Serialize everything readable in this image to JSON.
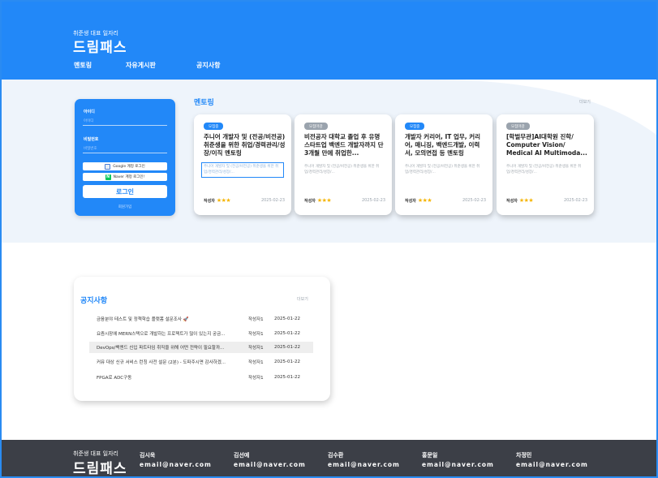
{
  "header": {
    "subtitle": "취준생 대표 일자리",
    "brand": "드림패스",
    "nav": [
      "멘토링",
      "자유게시판",
      "공지사항"
    ]
  },
  "login": {
    "id_label": "아이디",
    "id_placeholder": "아이디",
    "pw_label": "비밀번호",
    "pw_placeholder": "비밀번호",
    "google_label": "Google 계정 로그인",
    "naver_label": "Naver 계정 로그인!",
    "login_button": "로그인",
    "signup_link": "회원가입"
  },
  "mentoring": {
    "title": "멘토링",
    "more": "더보기",
    "cards": [
      {
        "badge": "모집중",
        "status": "open",
        "title": "주니어 개발자 및 (전공/비전공) 취준생을 위한 취업/경력관리/성장/이직 멘토링",
        "desc": "주니어 개발자 및 (전공/비전공) 취준생을 위한 취업/경력관리/성장/...",
        "author": "작성자",
        "stars": "★★★",
        "date": "2025-02-23"
      },
      {
        "badge": "모집마감",
        "status": "closed",
        "title": "비전공자 대학교 졸업 후 유명 스타트업 백엔드 개발자까지 단 3개월 만에 취업한...",
        "desc": "주니어 개발자 및 (전공/비전공) 취준생을 위한 취업/경력관리/성장/...",
        "author": "작성자",
        "stars": "★★★",
        "date": "2025-02-23"
      },
      {
        "badge": "모집중",
        "status": "open",
        "title": "개발자 커리어, IT 업무, 커리어, 매니징, 백엔드개발, 이력서, 모의면접 등 멘토링",
        "desc": "주니어 개발자 및 (전공/비전공) 취준생을 위한 취업/경력관리/성장/...",
        "author": "작성자",
        "stars": "★★★",
        "date": "2025-02-23"
      },
      {
        "badge": "모집마감",
        "status": "closed",
        "title": "[학벌무관]AI대학원 진학/ Computer Vision/ Medical AI Multimoda...",
        "desc": "주니어 개발자 및 (전공/비전공) 취준생을 위한 취업/경력관리/성장/...",
        "author": "작성자",
        "stars": "★★★",
        "date": "2025-02-23"
      }
    ]
  },
  "notices": {
    "title": "공지사항",
    "more": "더보기",
    "rows": [
      {
        "title": "금융분야 테스트 및 정책학습 플랫폼 설문조사 🚀",
        "author": "작성자1",
        "date": "2025-01-22"
      },
      {
        "title": "요즘시장에 MERN스택으로 개발하는 프로젝트가 많이 있는지 궁금...",
        "author": "작성자1",
        "date": "2025-01-22"
      },
      {
        "title": "DevOps/백엔드 신입 파트타임 취직을 위해 어떤 전략이 필요할까...",
        "author": "작성자1",
        "date": "2025-01-22"
      },
      {
        "title": "커뮤 대상 신규 서비스 런칭 사전 설문 (2분) - 도파주시면 감사하겠...",
        "author": "작성자1",
        "date": "2025-01-22"
      },
      {
        "title": "FPGA로 ADC구동",
        "author": "작성자1",
        "date": "2025-01-22"
      }
    ]
  },
  "footer": {
    "subtitle": "취준생 대표 일자리",
    "brand": "드림패스",
    "people": [
      {
        "name": "김시욱",
        "email": "email@naver.com"
      },
      {
        "name": "김선예",
        "email": "email@naver.com"
      },
      {
        "name": "김수환",
        "email": "email@naver.com"
      },
      {
        "name": "홍문일",
        "email": "email@naver.com"
      },
      {
        "name": "차정민",
        "email": "email@naver.com"
      }
    ]
  },
  "colors": {
    "primary": "#2288f8",
    "band": "#eef4fb",
    "footer": "#3c3f47",
    "star": "#f5b400"
  }
}
